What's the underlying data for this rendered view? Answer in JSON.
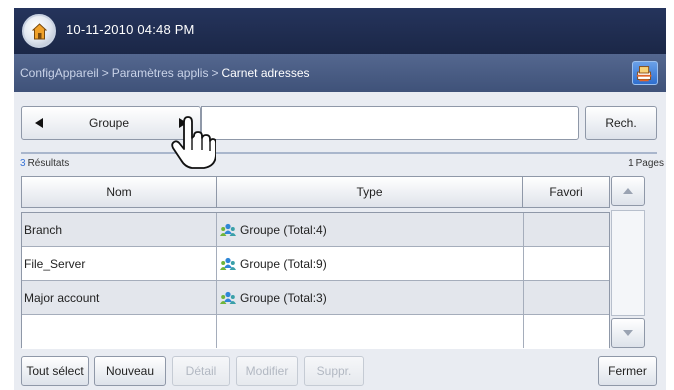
{
  "status_bar": {
    "datetime": "10-11-2010 04:48 PM"
  },
  "breadcrumb": {
    "item1": "ConfigAppareil",
    "item2": "Paramètres applis",
    "current": "Carnet adresses",
    "separator": ">"
  },
  "search": {
    "category": "Groupe",
    "value": "",
    "button_label": "Rech."
  },
  "results": {
    "count": "3",
    "results_label": "Résultats",
    "pages": "1",
    "pages_label": "Pages"
  },
  "table": {
    "headers": {
      "name": "Nom",
      "type": "Type",
      "favorite": "Favori"
    },
    "rows": [
      {
        "name": "Branch",
        "type": "Groupe (Total:4)",
        "favorite": ""
      },
      {
        "name": "File_Server",
        "type": "Groupe (Total:9)",
        "favorite": ""
      },
      {
        "name": "Major account",
        "type": "Groupe (Total:3)",
        "favorite": ""
      },
      {
        "name": "",
        "type": "",
        "favorite": ""
      }
    ]
  },
  "buttons": {
    "select_all": "Tout sélect",
    "new": "Nouveau",
    "detail": "Détail",
    "modify": "Modifier",
    "delete": "Suppr.",
    "close": "Fermer"
  },
  "colors": {
    "status_bar": "#25345c",
    "breadcrumb_bar": "#4a5d85",
    "accent_blue": "#3a74d6",
    "group_icon": "#2e86d6"
  },
  "icons": {
    "home": "home-icon",
    "job_status": "job-status-icon",
    "group": "group-icon",
    "cursor": "hand-cursor-icon"
  }
}
